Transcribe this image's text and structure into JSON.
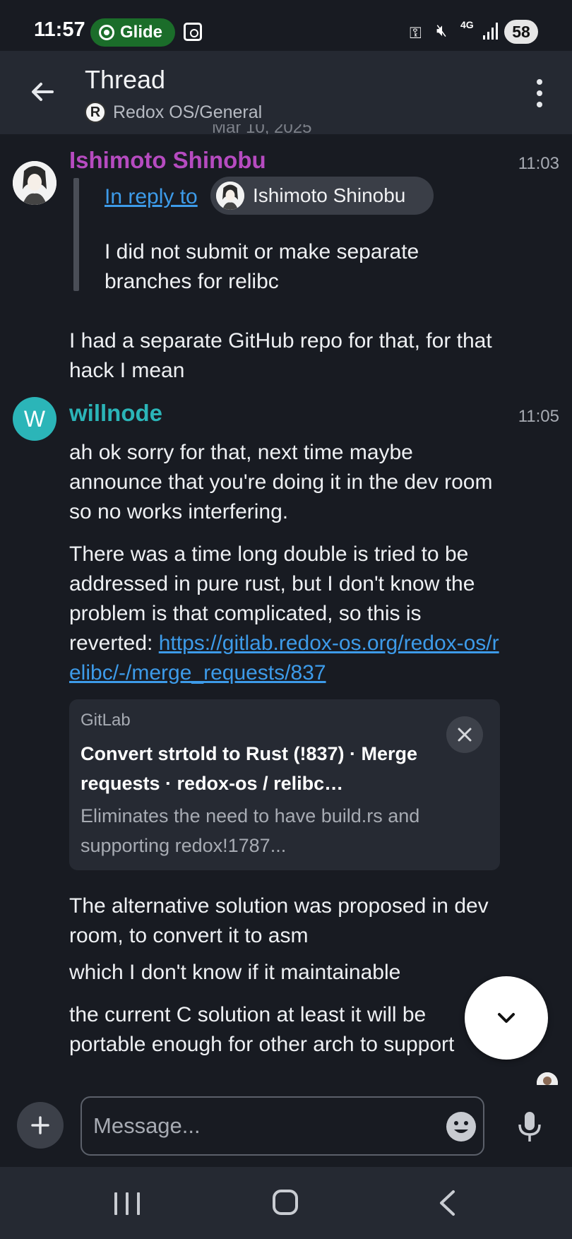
{
  "status_bar": {
    "time": "11:57",
    "app_pill": "Glide",
    "network": "4G",
    "battery": "58"
  },
  "header": {
    "title": "Thread",
    "room_icon_letter": "R",
    "room_name": "Redox OS/General"
  },
  "date_divider": "Mar 10, 2025",
  "messages": [
    {
      "sender": "Ishimoto Shinobu",
      "sender_color": "#b64bc0",
      "time": "11:03",
      "reply": {
        "link_text": "In reply to",
        "chip_name": "Ishimoto Shinobu",
        "text": "I did not submit or make separate branches for relibc"
      },
      "text": "I had a separate GitHub repo for that, for that hack I mean"
    },
    {
      "sender": "willnode",
      "sender_color": "#2bb5b8",
      "avatar_letter": "W",
      "time": "11:05",
      "paragraphs": [
        "ah ok sorry for that, next time maybe announce that you're doing it in the dev room so no works interfering.",
        "There was a time long double is tried to be addressed in pure rust, but I don't know the problem is that complicated, so this is reverted: "
      ],
      "link": "https://gitlab.redox-os.org/redox-os/relibc/-/merge_requests/837",
      "preview": {
        "site": "GitLab",
        "title": "Convert strtold to Rust (!837) · Merge requests · redox-os / relibc…",
        "description": "Eliminates the need to have build.rs and supporting redox!1787..."
      },
      "after": [
        "The alternative solution was proposed in dev room, to convert it to asm",
        "which I don't know if it maintainable",
        "the current C solution at least it will be portable enough for other arch to support"
      ]
    }
  ],
  "composer": {
    "placeholder": "Message..."
  },
  "icons": {
    "back": "arrow-left-icon",
    "menu": "more-vertical-icon",
    "scroll": "chevron-down-icon",
    "add": "plus-icon",
    "emoji": "emoji-icon",
    "mic": "microphone-icon"
  }
}
